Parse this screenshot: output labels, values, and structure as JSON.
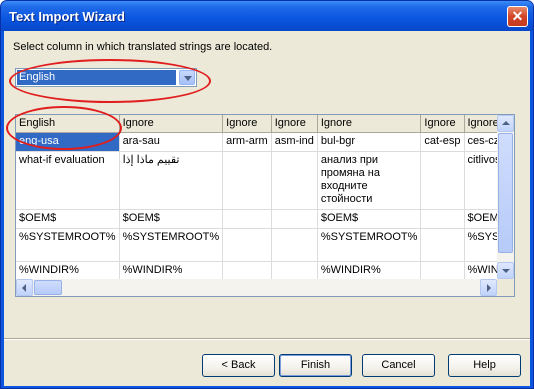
{
  "window": {
    "title": "Text Import Wizard",
    "close_label": "✕"
  },
  "instruction": "Select column in which translated strings are located.",
  "column_select": {
    "value": "English"
  },
  "grid": {
    "headers": [
      "English",
      "Ignore",
      "Ignore",
      "Ignore",
      "Ignore",
      "Ignore",
      "Ignore"
    ],
    "rows": [
      [
        "eng-usa",
        "ara-sau",
        "arm-arm",
        "asm-ind",
        "bul-bgr",
        "cat-esp",
        "ces-cze"
      ],
      [
        "what-if evaluation",
        "تقييم ماذا إذا",
        "",
        "",
        "анализ при промяна на входните стойности",
        "",
        "citlivostn"
      ],
      [
        "$OEM$",
        "$OEM$",
        "",
        "",
        "$OEM$",
        "",
        "$OEM$"
      ],
      [
        "%SYSTEMROOT%",
        "%SYSTEMROOT%",
        "",
        "",
        "%SYSTEMROOT%",
        "",
        "%SYSTE"
      ],
      [
        "%WINDIR%",
        "%WINDIR%",
        "",
        "",
        "%WINDIR%",
        "",
        "%WINDI"
      ]
    ]
  },
  "buttons": {
    "back": "< Back",
    "finish": "Finish",
    "cancel": "Cancel",
    "help": "Help"
  },
  "colors": {
    "title_bar": "#0a55e0",
    "selection": "#316ac5",
    "highlight_oval": "#e11d1d"
  }
}
